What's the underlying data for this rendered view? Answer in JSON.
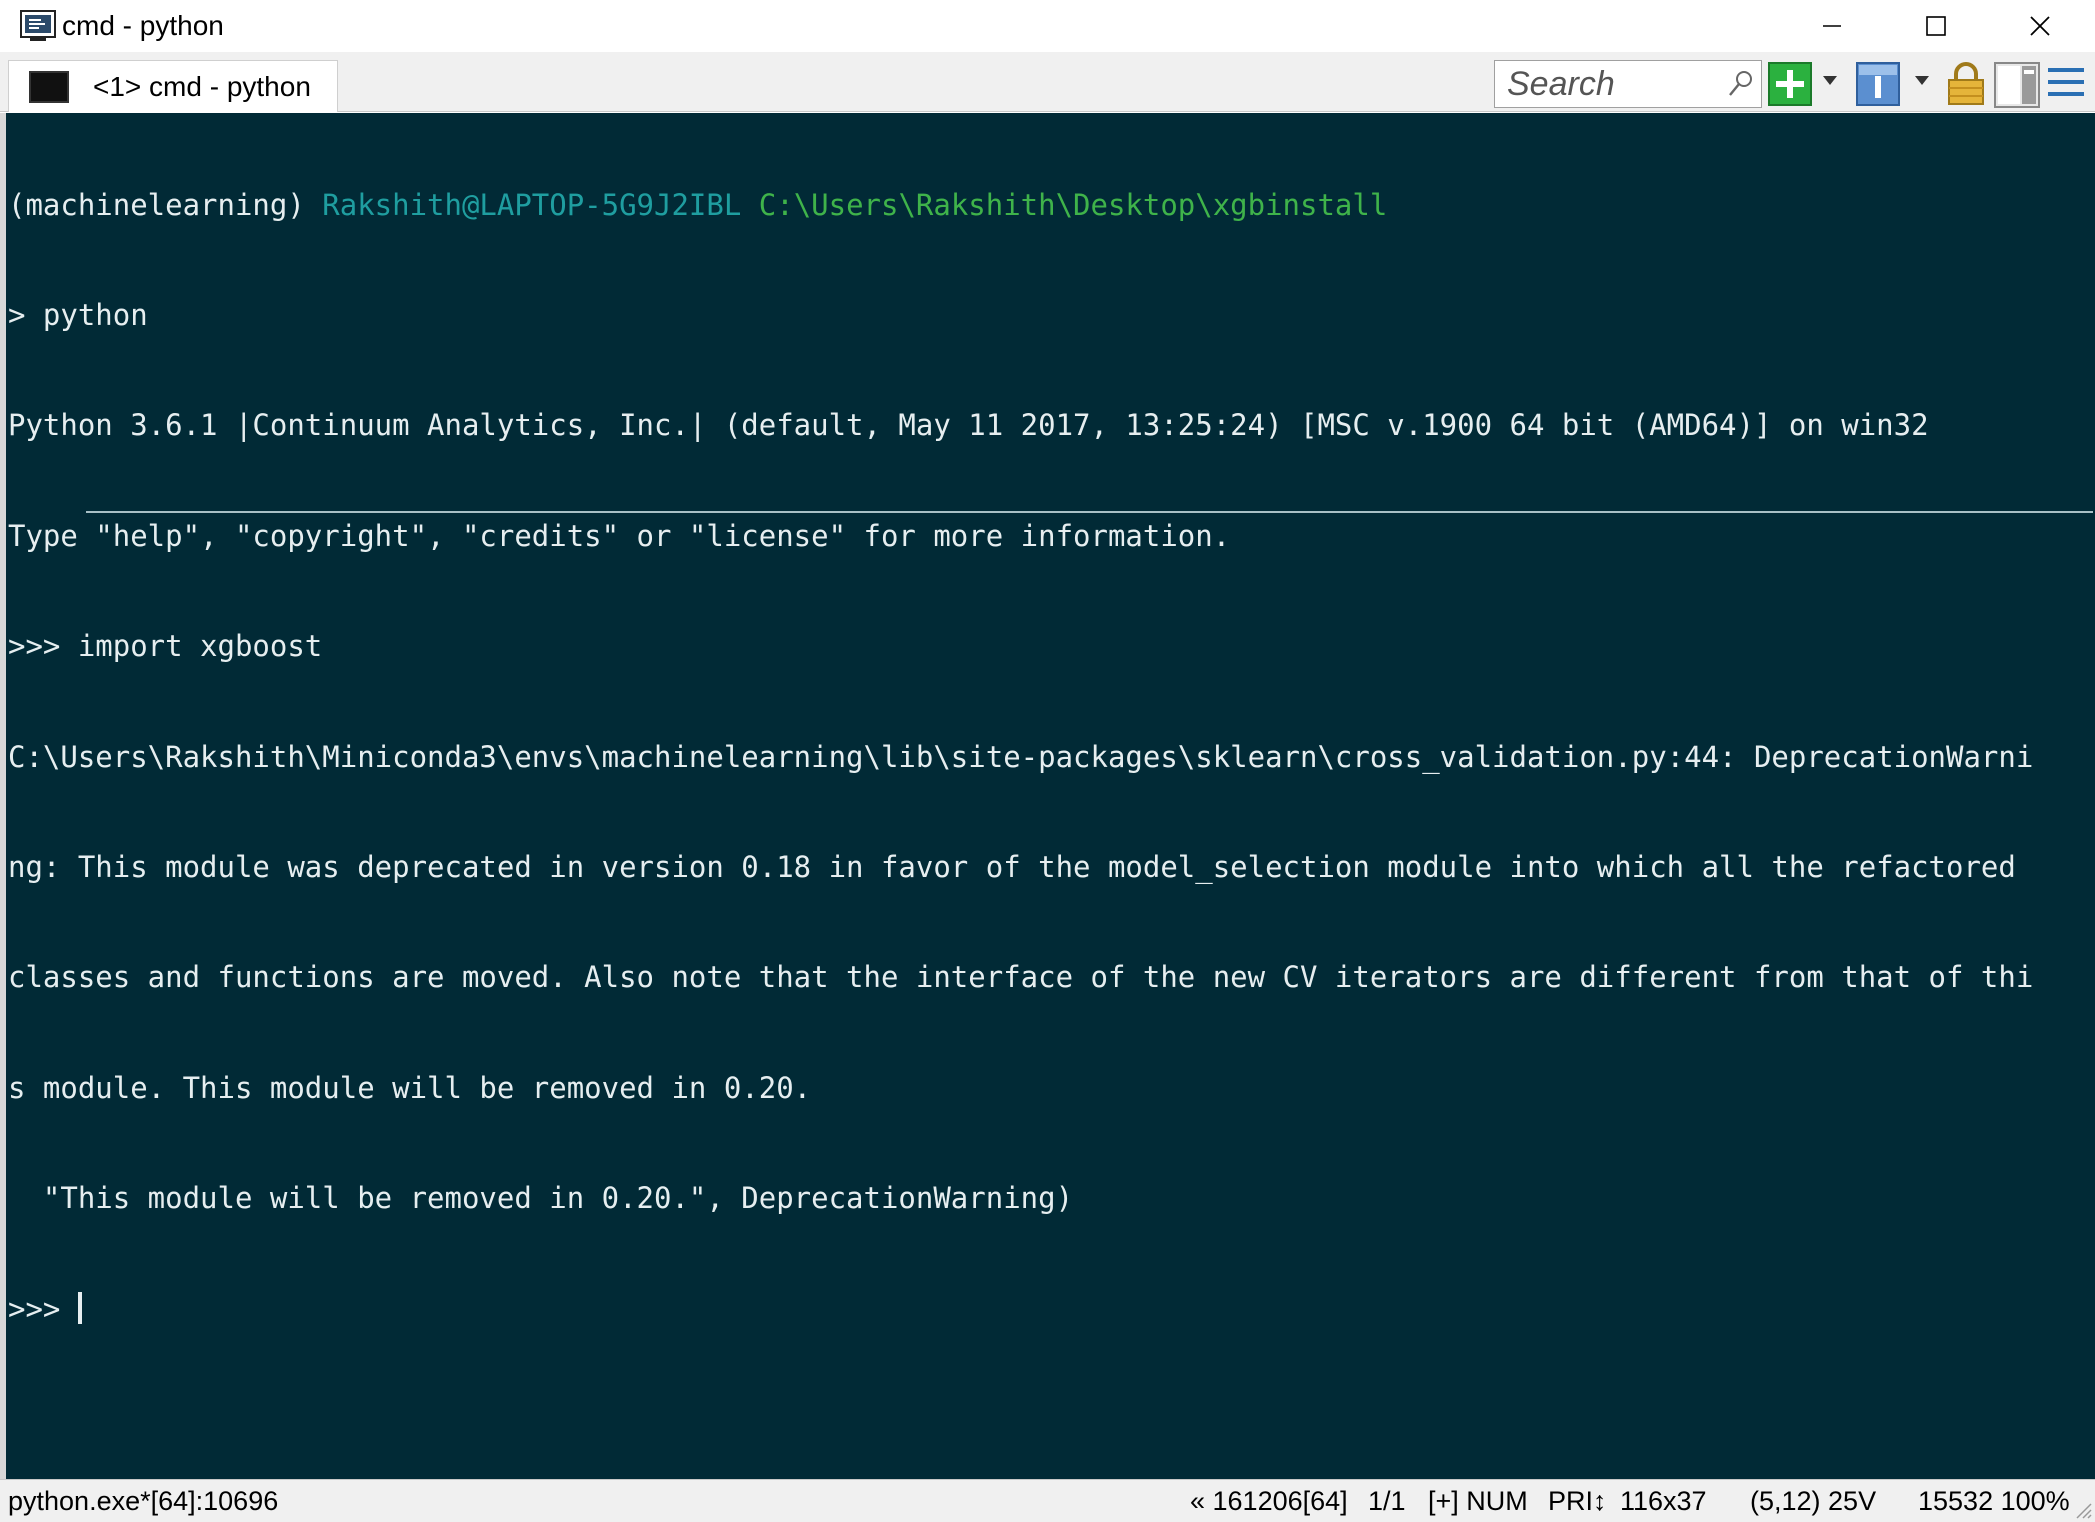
{
  "window": {
    "title": "cmd - python"
  },
  "tabs": [
    {
      "label": "<1> cmd - python"
    }
  ],
  "search": {
    "placeholder": "Search"
  },
  "terminal": {
    "prompt_env": "(machinelearning) ",
    "prompt_user": "Rakshith@LAPTOP-5G9J2IBL",
    "prompt_path": " C:\\Users\\Rakshith\\Desktop\\xgbinstall",
    "lines": [
      "> python",
      "Python 3.6.1 |Continuum Analytics, Inc.| (default, May 11 2017, 13:25:24) [MSC v.1900 64 bit (AMD64)] on win32",
      "Type \"help\", \"copyright\", \"credits\" or \"license\" for more information.",
      ">>> import xgboost",
      "C:\\Users\\Rakshith\\Miniconda3\\envs\\machinelearning\\lib\\site-packages\\sklearn\\cross_validation.py:44: DeprecationWarni",
      "ng: This module was deprecated in version 0.18 in favor of the model_selection module into which all the refactored",
      "classes and functions are moved. Also note that the interface of the new CV iterators are different from that of thi",
      "s module. This module will be removed in 0.20.",
      "  \"This module will be removed in 0.20.\", DeprecationWarning)"
    ],
    "current_prompt": ">>> "
  },
  "statusbar": {
    "process": "python.exe*[64]:10696",
    "info": "« 161206[64]",
    "console_index": "1/1",
    "mode": "[+] NUM",
    "priority": "PRI↕",
    "size": "116x37",
    "cursor_pos": "(5,12) 25V",
    "zoom": "15532 100%"
  },
  "icons": {
    "app": "console-app-icon",
    "minimize": "minimize-icon",
    "maximize": "maximize-icon",
    "close": "close-icon",
    "search": "search-icon",
    "new_console": "plus-icon",
    "dropdown": "chevron-down-icon",
    "info": "info-icon",
    "lock": "lock-icon",
    "split": "split-view-icon",
    "menu": "hamburger-menu-icon"
  },
  "colors": {
    "terminal_bg": "#012a36",
    "prompt_user": "#1f9ea0",
    "prompt_path": "#3fb34a",
    "text": "#e6eef0",
    "new_console_green": "#2bb13f"
  }
}
